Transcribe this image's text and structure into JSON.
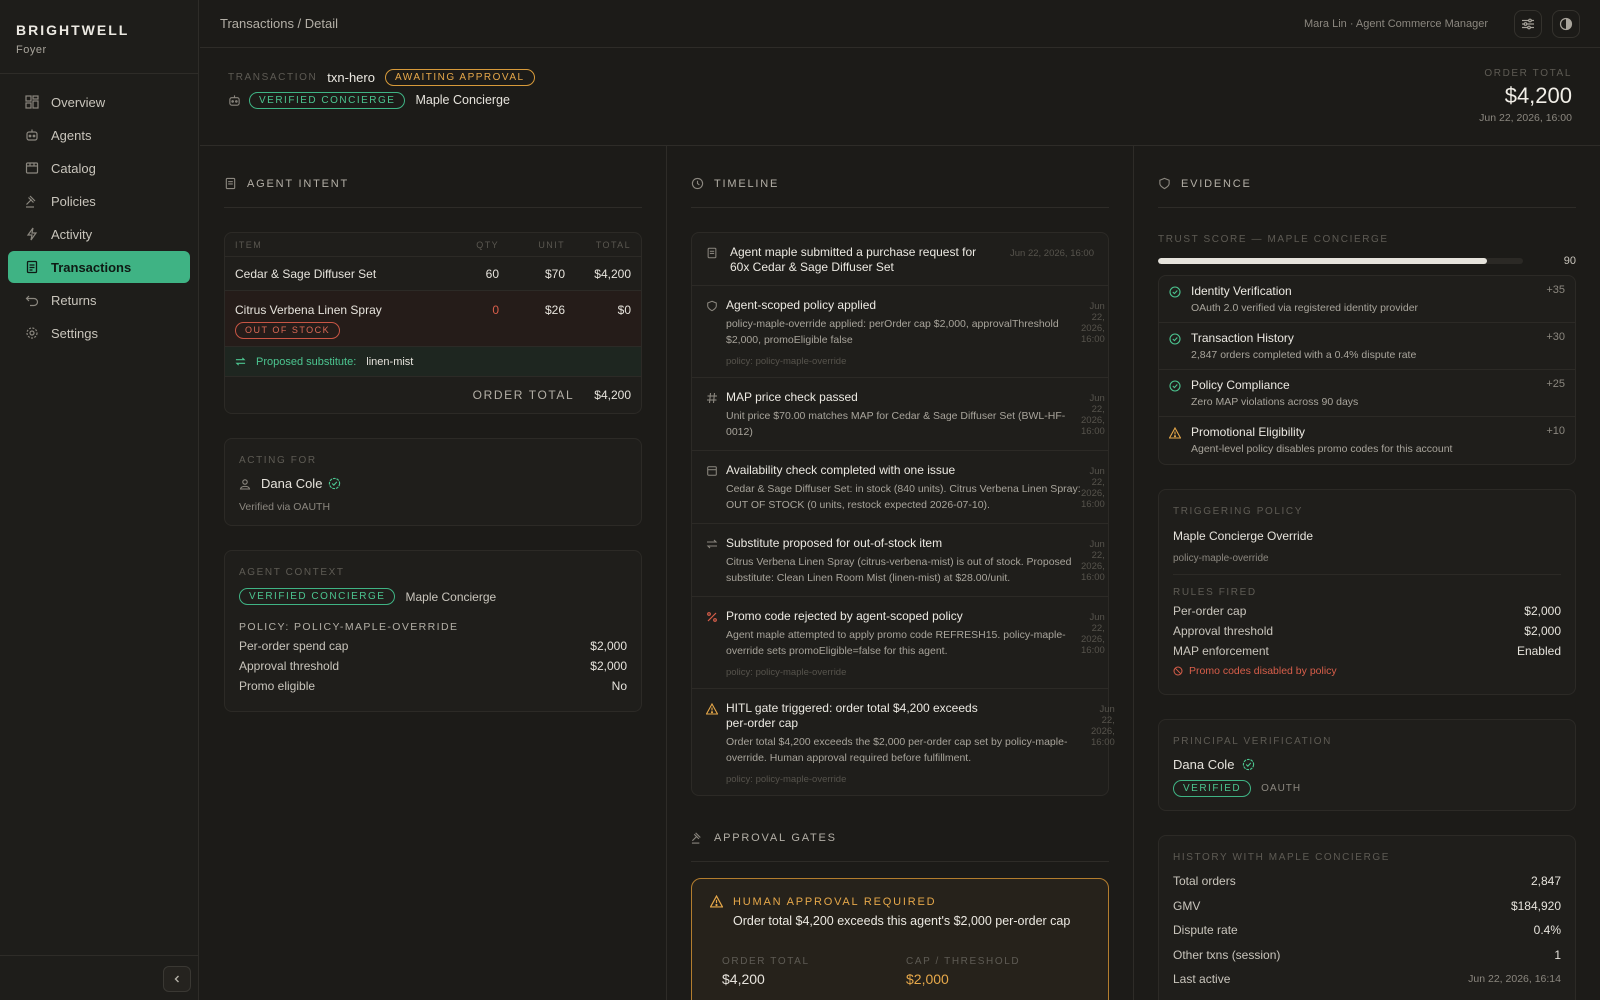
{
  "brand": {
    "name": "BRIGHTWELL",
    "sub": "Foyer"
  },
  "nav": [
    {
      "label": "Overview",
      "icon": "dashboard-icon"
    },
    {
      "label": "Agents",
      "icon": "bot-icon"
    },
    {
      "label": "Catalog",
      "icon": "catalog-icon"
    },
    {
      "label": "Policies",
      "icon": "gavel-icon"
    },
    {
      "label": "Activity",
      "icon": "bolt-icon"
    },
    {
      "label": "Transactions",
      "icon": "receipt-icon",
      "active": true
    },
    {
      "label": "Returns",
      "icon": "return-icon"
    },
    {
      "label": "Settings",
      "icon": "gear-icon"
    }
  ],
  "topbar": {
    "breadcrumb": "Transactions / Detail",
    "user": "Mara Lin · Agent Commerce Manager"
  },
  "header": {
    "txn_label": "TRANSACTION",
    "txn_id": "txn-hero",
    "status": "AWAITING APPROVAL",
    "agent_badge": "VERIFIED CONCIERGE",
    "agent_name": "Maple Concierge",
    "order_total_label": "ORDER TOTAL",
    "order_total": "$4,200",
    "timestamp": "Jun 22, 2026, 16:00"
  },
  "intent": {
    "title": "AGENT INTENT",
    "columns": [
      "ITEM",
      "QTY",
      "UNIT",
      "TOTAL"
    ],
    "rows": [
      {
        "item": "Cedar & Sage Diffuser Set",
        "qty": "60",
        "unit": "$70",
        "total": "$4,200"
      },
      {
        "item": "Citrus Verbena Linen Spray",
        "qty": "0",
        "unit": "$26",
        "total": "$0",
        "badge": "OUT OF STOCK"
      }
    ],
    "substitute_label": "Proposed substitute:",
    "substitute_value": "linen-mist",
    "total_label": "ORDER TOTAL",
    "total_value": "$4,200"
  },
  "acting_for": {
    "label": "ACTING FOR",
    "name": "Dana Cole",
    "verified_via": "Verified via OAUTH"
  },
  "agent_context": {
    "label": "AGENT CONTEXT",
    "badge": "VERIFIED CONCIERGE",
    "agent_name": "Maple Concierge",
    "policy_label": "POLICY: POLICY-MAPLE-OVERRIDE",
    "rows": [
      {
        "k": "Per-order spend cap",
        "v": "$2,000"
      },
      {
        "k": "Approval threshold",
        "v": "$2,000"
      },
      {
        "k": "Promo eligible",
        "v": "No"
      }
    ]
  },
  "timeline": {
    "title": "TIMELINE",
    "items": [
      {
        "icon": "receipt-icon",
        "title": "Agent maple submitted a purchase request for 60x Cedar & Sage Diffuser Set",
        "desc": "",
        "policy": "",
        "time": "Jun 22, 2026, 16:00"
      },
      {
        "icon": "shield-icon",
        "title": "Agent-scoped policy applied",
        "desc": "policy-maple-override applied: perOrder cap $2,000, approvalThreshold $2,000, promoEligible false",
        "policy": "policy: policy-maple-override",
        "time": "Jun 22, 2026, 16:00"
      },
      {
        "icon": "hash-icon",
        "title": "MAP price check passed",
        "desc": "Unit price $70.00 matches MAP for Cedar & Sage Diffuser Set (BWL-HF-0012)",
        "policy": "",
        "time": "Jun 22, 2026, 16:00"
      },
      {
        "icon": "box-icon",
        "title": "Availability check completed with one issue",
        "desc": "Cedar & Sage Diffuser Set: in stock (840 units). Citrus Verbena Linen Spray: OUT OF STOCK (0 units, restock expected 2026-07-10).",
        "policy": "",
        "time": "Jun 22, 2026, 16:00"
      },
      {
        "icon": "swap-icon",
        "title": "Substitute proposed for out-of-stock item",
        "desc": "Citrus Verbena Linen Spray (citrus-verbena-mist) is out of stock. Proposed substitute: Clean Linen Room Mist (linen-mist) at $28.00/unit.",
        "policy": "",
        "time": "Jun 22, 2026, 16:00"
      },
      {
        "icon": "percent-icon",
        "title": "Promo code rejected by agent-scoped policy",
        "desc": "Agent maple attempted to apply promo code REFRESH15. policy-maple-override sets promoEligible=false for this agent.",
        "policy": "policy: policy-maple-override",
        "time": "Jun 22, 2026, 16:00"
      },
      {
        "icon": "warning-icon",
        "title": "HITL gate triggered: order total $4,200 exceeds per-order cap",
        "desc": "Order total $4,200 exceeds the $2,000 per-order cap set by policy-maple-override. Human approval required before fulfillment.",
        "policy": "policy: policy-maple-override",
        "time": "Jun 22, 2026, 16:00"
      }
    ]
  },
  "gates": {
    "title": "APPROVAL GATES",
    "gate_title": "HUMAN APPROVAL REQUIRED",
    "gate_desc": "Order total $4,200 exceeds this agent's $2,000 per-order cap",
    "order_total_label": "ORDER TOTAL",
    "order_total": "$4,200",
    "cap_label": "CAP / THRESHOLD",
    "cap": "$2,000"
  },
  "evidence": {
    "title": "EVIDENCE",
    "trust_label": "TRUST SCORE — MAPLE CONCIERGE",
    "trust_score": "90",
    "trust_fraction": 0.9,
    "factors": [
      {
        "icon": "check-circle-icon",
        "title": "Identity Verification",
        "desc": "OAuth 2.0 verified via registered identity provider",
        "pts": "+35"
      },
      {
        "icon": "check-circle-icon",
        "title": "Transaction History",
        "desc": "2,847 orders completed with a 0.4% dispute rate",
        "pts": "+30"
      },
      {
        "icon": "check-circle-icon",
        "title": "Policy Compliance",
        "desc": "Zero MAP violations across 90 days",
        "pts": "+25"
      },
      {
        "icon": "warning-icon",
        "title": "Promotional Eligibility",
        "desc": "Agent-level policy disables promo codes for this account",
        "pts": "+10"
      }
    ],
    "triggering": {
      "label": "TRIGGERING POLICY",
      "name": "Maple Concierge Override",
      "id": "policy-maple-override",
      "rules_label": "RULES FIRED",
      "rules": [
        {
          "k": "Per-order cap",
          "v": "$2,000"
        },
        {
          "k": "Approval threshold",
          "v": "$2,000"
        },
        {
          "k": "MAP enforcement",
          "v": "Enabled"
        }
      ],
      "note": "Promo codes disabled by policy"
    },
    "principal": {
      "label": "PRINCIPAL VERIFICATION",
      "name": "Dana Cole",
      "badge": "VERIFIED",
      "method": "OAUTH"
    },
    "history": {
      "label": "HISTORY WITH MAPLE CONCIERGE",
      "rows": [
        {
          "k": "Total orders",
          "v": "2,847"
        },
        {
          "k": "GMV",
          "v": "$184,920"
        },
        {
          "k": "Dispute rate",
          "v": "0.4%"
        },
        {
          "k": "Other txns (session)",
          "v": "1"
        },
        {
          "k": "Last active",
          "v": "Jun 22, 2026, 16:14"
        }
      ]
    }
  },
  "colors": {
    "accent": "#3fb384",
    "amber": "#e6a84a",
    "danger": "#d85e4a"
  }
}
